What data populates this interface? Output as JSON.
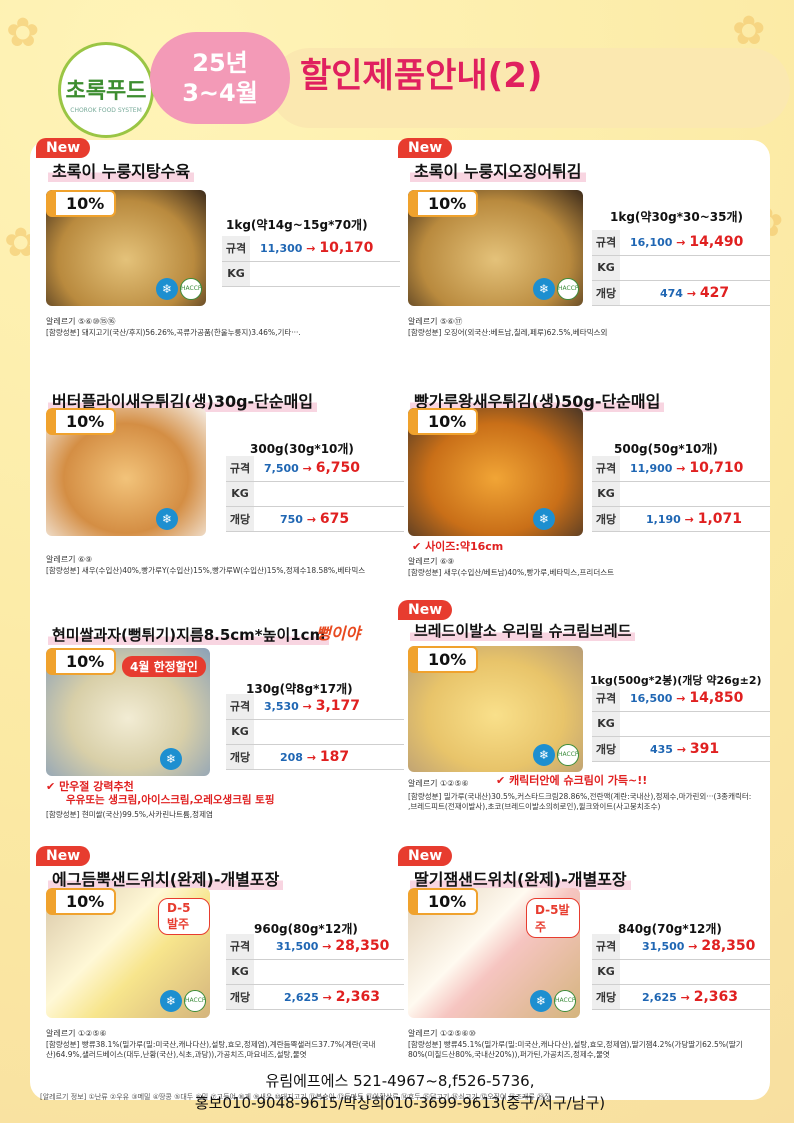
{
  "header": {
    "logo_text": "초록푸드",
    "logo_sub": "CHOROK FOOD SYSTEM",
    "period_line1": "25년",
    "period_line2": "3~4월",
    "title": "할인제품안내(2)"
  },
  "colors": {
    "title_pink": "#e0205f",
    "old_price_blue": "#1f66b3",
    "new_price_red": "#e02020",
    "discount_orange": "#f0a22d",
    "new_badge_red": "#e73c2f"
  },
  "labels": {
    "new_badge": "New",
    "spec": "규격",
    "kg": "KG",
    "each": "개당",
    "arrow": "→",
    "freeze": "❄",
    "haccp": "HACCP"
  },
  "products": [
    {
      "name": "초록이 누룽지탕수육",
      "discount": "10%",
      "weight": "1kg(약14g~15g*70개)",
      "spec_old": "11,300",
      "spec_new": "10,170",
      "each_old": "",
      "each_new": "",
      "allergy": "알레르기 ⑤⑥⑩⑮⑯",
      "ingredients": "[함량성분] 돼지고기(국산/후지)56.26%,곡류가공품(한울누룽지)3.46%,기타···."
    },
    {
      "name": "초록이 누룽지오징어튀김",
      "discount": "10%",
      "weight": "1kg(약30g*30~35개)",
      "spec_old": "16,100",
      "spec_new": "14,490",
      "each_old": "474",
      "each_new": "427",
      "allergy": "알레르기 ⑤⑥⑰",
      "ingredients": "[함량성분] 오징어(외국산:베트남,칠레,페루)62.5%,베타믹스외"
    },
    {
      "name": "버터플라이새우튀김(생)30g-단순매입",
      "discount": "10%",
      "weight": "300g(30g*10개)",
      "spec_old": "7,500",
      "spec_new": "6,750",
      "each_old": "750",
      "each_new": "675",
      "allergy": "알레르기 ⑥⑨",
      "ingredients": "[함량성분] 새우(수입산)40%,빵가루Y(수입산)15%,빵가루W(수입산)15%,정제수18.58%,베타믹스"
    },
    {
      "name": "빵가루왕새우튀김(생)50g-단순매입",
      "discount": "10%",
      "weight": "500g(50g*10개)",
      "spec_old": "11,900",
      "spec_new": "10,710",
      "each_old": "1,190",
      "each_new": "1,071",
      "size_note": "사이즈:약16cm",
      "allergy": "알레르기 ⑥⑨",
      "ingredients": "[함량성분] 새우(수입산/베트남)40%,빵가루,베타믹스,프리더스트"
    },
    {
      "name": "현미쌀과자(뻥튀기)지름8.5cm*높이1cm",
      "name_deco": "뻥이야",
      "discount": "10%",
      "promo": "4월 한정할인",
      "weight": "130g(약8g*17개)",
      "spec_old": "3,530",
      "spec_new": "3,177",
      "each_old": "208",
      "each_new": "187",
      "recommend_line1": "만우절 강력추천",
      "recommend_line2": "우유또는 생크림,아이스크림,오레오생크림 토핑",
      "ingredients": "[함량성분] 현미쌀(국산)99.5%,사카린나트륨,정제염"
    },
    {
      "name": "브레드이발소 우리밀 슈크림브레드",
      "discount": "10%",
      "weight": "1kg(500g*2봉)(개당 약26g±2)",
      "spec_old": "16,500",
      "spec_new": "14,850",
      "each_old": "435",
      "each_new": "391",
      "character_note": "캐릭터안에 슈크림이 가득~!!",
      "allergy": "알레르기 ①②⑤⑥",
      "ingredients": "[함량성분] 밀가루(국내산)30.5%,커스타드크림28.86%,전란액(계란:국내산),정제수,마가린외···(3종캐릭터: ,브레드피트(전재이발사),초코(브레드이발소의히로인),윌크와이트(사고뭉치조수)"
    },
    {
      "name": "에그듬뿍샌드위치(완제)-개별포장",
      "discount": "10%",
      "order_tag": "D-5발주",
      "weight": "960g(80g*12개)",
      "spec_old": "31,500",
      "spec_new": "28,350",
      "each_old": "2,625",
      "each_new": "2,363",
      "allergy": "알레르기 ①②⑤⑥",
      "ingredients": "[함량성분] 빵류38.1%(밀가루(밀:미국산,캐나다산),설탕,효모,정제염),계란듬뿍샐러드37.7%(계란(국내산)64.9%,샐러드베이스(대두,난황(국산),식초,과당)),가공치즈,마요네즈,설탕,물엿"
    },
    {
      "name": "딸기잼샌드위치(완제)-개별포장",
      "discount": "10%",
      "order_tag": "D-5발주",
      "weight": "840g(70g*12개)",
      "spec_old": "31,500",
      "spec_new": "28,350",
      "each_old": "2,625",
      "each_new": "2,363",
      "allergy": "알레르기 ①②⑤⑥⑩",
      "ingredients": "[함량성분] 빵류45.1%(밀가루(밀:미국산,캐나다산),설탕,효모,정제염),딸기잼4.2%(가당딸기62.5%(딸기80%(미칠드산80%,국내산20%)),퍼가틴,가공치즈,정제수,물엿"
    }
  ],
  "footer": {
    "allergy_legend": "[알레르기 정보] ①난류 ②우유 ③메밀 ④땅콩 ⑤대두 ⑥밀 ⑦고등어 ⑧게 ⑨새우 ⑩돼지고기 ⑪복숭아 ⑫토마토 ⑬아황산류 ⑭호두 ⑮닭고기 ⑯쇠고기 ⑰오징어 ⑱조개류 ⑲잣",
    "contact_line1": "유림에프에스 521-4967~8,f526-5736,",
    "contact_line2": "홍보010-9048-9615/박상희010-3699-9613(중구/서구/남구)"
  }
}
